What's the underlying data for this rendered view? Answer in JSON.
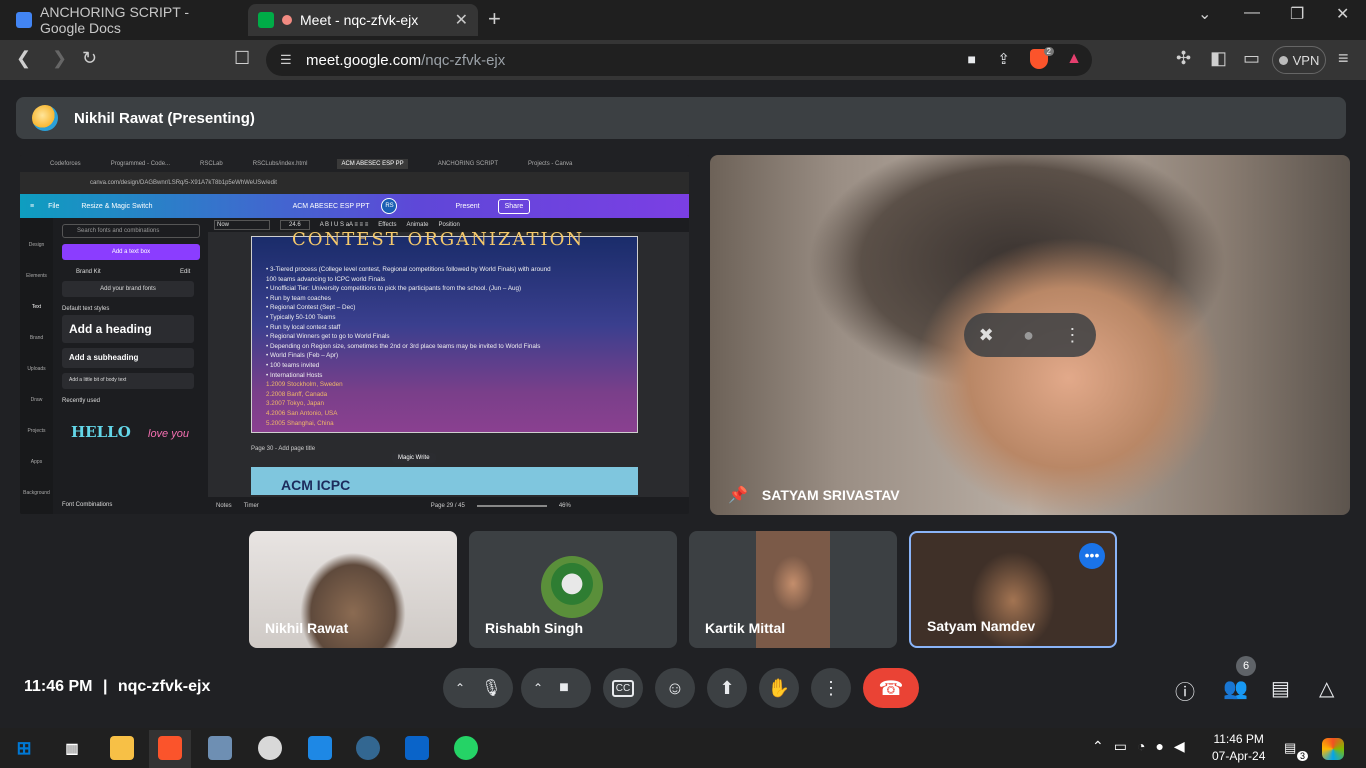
{
  "browser": {
    "tabs": [
      {
        "title": "ANCHORING SCRIPT - Google Docs",
        "favicon_color": "#4285f4"
      },
      {
        "title": "Meet - nqc-zfvk-ejx",
        "favicon_color": "#00ac47"
      }
    ],
    "new_tab_symbol": "+",
    "window_controls": [
      "⌄",
      "—",
      "❐",
      "✕"
    ],
    "url_host": "meet.google.com",
    "url_path": "/nqc-zfvk-ejx",
    "brave_badge": "2",
    "vpn_label": "VPN"
  },
  "meet": {
    "presenting_label": "Nikhil Rawat (Presenting)",
    "shared_screen": {
      "browser_tabs": [
        "Codeforces",
        "Programmed - Code...",
        "RSCLab",
        "RSCLubs/index.html",
        "ACM ABESEC ESP PP",
        "ANCHORING SCRIPT",
        "Projects - Canva"
      ],
      "url": "canva.com/design/DAGBwnr/LSRq/5-X91A7kT8b1p5eWhWeUSw/edit",
      "header": {
        "file": "File",
        "resize": "Resize & Magic Switch",
        "doc_title": "ACM ABESEC ESP PPT",
        "present": "Present",
        "share": "Share"
      },
      "toolbar": {
        "font": "Now",
        "size": "24.6",
        "effects": "Effects",
        "animate": "Animate",
        "position": "Position"
      },
      "sidebar": [
        "Design",
        "Elements",
        "Text",
        "Brand",
        "Uploads",
        "Draw",
        "Projects",
        "Apps",
        "Background"
      ],
      "panel": {
        "search_placeholder": "Search fonts and combinations",
        "add_text_box": "Add a text box",
        "brand_kit": "Brand Kit",
        "edit": "Edit",
        "add_brand_fonts": "Add your brand fonts",
        "default_styles": "Default text styles",
        "add_heading": "Add a heading",
        "add_subheading": "Add a subheading",
        "add_body": "Add a little bit of body text",
        "recently_used": "Recently used",
        "font_combinations": "Font Combinations"
      },
      "slide_title": "CONTEST ORGANIZATION",
      "slide_lines": [
        "•  3-Tiered process (College level contest, Regional competitions followed by World Finals) with around",
        "   100 teams advancing to ICPC world Finals",
        "•  Unofficial Tier: University competitions to pick the participants from the school. (Jun – Aug)",
        "•  Run by team coaches",
        "•  Regional Contest (Sept – Dec)",
        "•  Typically 50-100 Teams",
        "•  Run by local contest staff",
        "•  Regional Winners get to go to World Finals",
        "•  Depending on Region size, sometimes the 2nd or 3rd place teams may be invited to World Finals",
        "•  World Finals (Feb – Apr)",
        "•  100 teams invited",
        "•  International Hosts"
      ],
      "slide_hosts": [
        "1.2009 Stockholm, Sweden",
        "2.2008 Banff, Canada",
        "3.2007 Tokyo, Japan",
        "4.2006 San Antonio, USA",
        "5.2005 Shanghai, China"
      ],
      "page_label": "Page 30 - Add page title",
      "magic_write": "Magic Write",
      "next_slide_text": "ACM ICPC",
      "footer": {
        "notes": "Notes",
        "timer": "Timer",
        "page": "Page 29 / 45",
        "zoom": "46%"
      }
    },
    "spotlight": {
      "name": "SATYAM SRIVASTAV"
    },
    "participants": [
      {
        "name": "Nikhil Rawat"
      },
      {
        "name": "Rishabh Singh"
      },
      {
        "name": "Kartik Mittal"
      },
      {
        "name": "Satyam Namdev"
      }
    ],
    "bottom": {
      "time": "11:46 PM",
      "separator": "|",
      "meeting_code": "nqc-zfvk-ejx",
      "participant_count": "6"
    }
  },
  "taskbar": {
    "apps": [
      "start",
      "task-view",
      "file-explorer",
      "brave",
      "photos",
      "paint",
      "vscode",
      "postgres",
      "outlook",
      "whatsapp"
    ],
    "time": "11:46 PM",
    "date": "07-Apr-24",
    "notifications": "3"
  }
}
